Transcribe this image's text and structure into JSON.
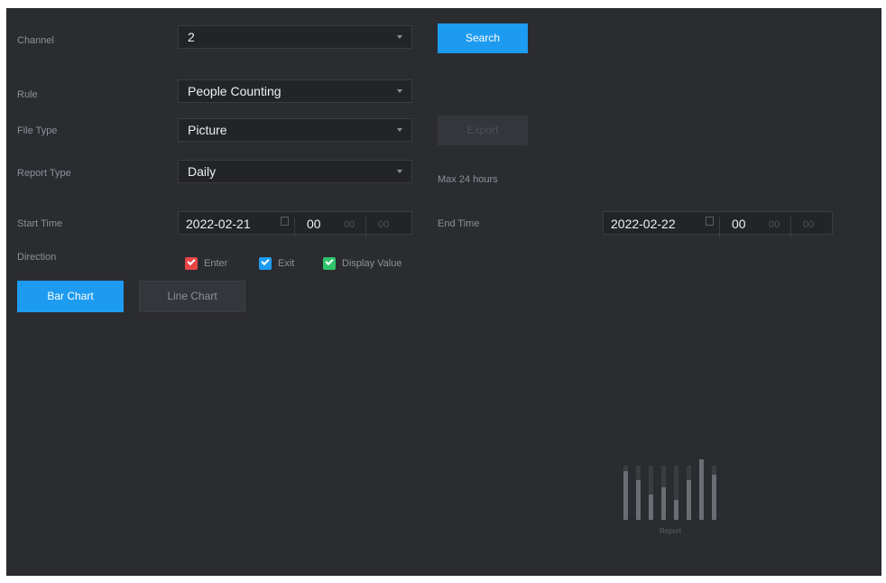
{
  "form": {
    "channel_label": "Channel",
    "channel_value": "2",
    "rule_label": "Rule",
    "rule_value": "People Counting",
    "file_type_label": "File Type",
    "file_type_value": "Picture",
    "report_type_label": "Report Type",
    "report_type_value": "Daily",
    "max_hint": "Max 24 hours",
    "start_time_label": "Start Time",
    "start_date": "2022-02-21",
    "start_hour": "00",
    "start_min": "00",
    "start_sec": "00",
    "end_time_label": "End Time",
    "end_date": "2022-02-22",
    "end_hour": "00",
    "end_min": "00",
    "end_sec": "00",
    "direction_label": "Direction"
  },
  "direction_options": [
    {
      "label": "Enter",
      "color": "#e84646"
    },
    {
      "label": "Exit",
      "color": "#1d9bf0"
    },
    {
      "label": "Display Value",
      "color": "#2fc36a"
    }
  ],
  "buttons": {
    "search": "Search",
    "export": "Export"
  },
  "tabs": {
    "bar_chart": "Bar Chart",
    "line_chart": "Line Chart"
  },
  "empty_state": {
    "icon": "bar-chart-icon",
    "text": "Report"
  },
  "colors": {
    "accent": "#1d9bf0",
    "panel_bg": "#2b2c30"
  }
}
